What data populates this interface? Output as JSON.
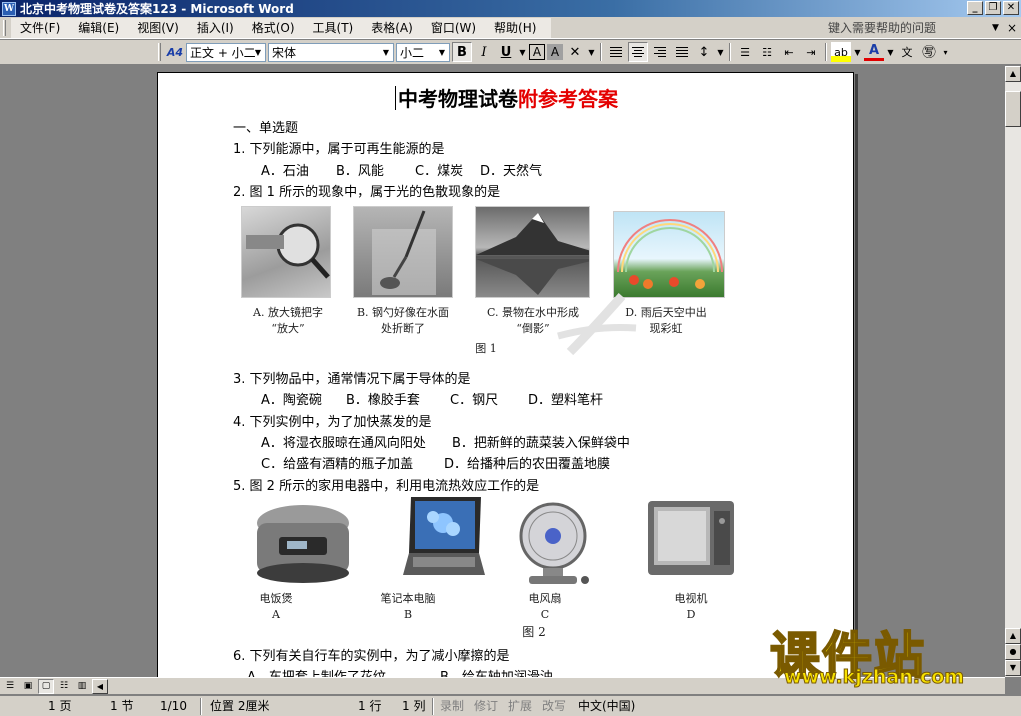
{
  "window": {
    "title": "北京中考物理试卷及答案123 - Microsoft Word",
    "min": "_",
    "restore": "❐",
    "close": "✕"
  },
  "menu": {
    "items": [
      "文件(F)",
      "编辑(E)",
      "视图(V)",
      "插入(I)",
      "格式(O)",
      "工具(T)",
      "表格(A)",
      "窗口(W)",
      "帮助(H)"
    ],
    "help_placeholder": "键入需要帮助的问题",
    "doc_close": "×"
  },
  "toolbar": {
    "style_value": "正文 + 小二",
    "font_value": "宋体",
    "size_value": "小二",
    "bold": "B",
    "italic": "I",
    "underline": "U",
    "char_border": "A",
    "char_shading": "A",
    "font_color": "A",
    "phonetic": "文"
  },
  "document": {
    "title_black": "中考物理试卷",
    "title_red": "附参考答案",
    "section": "一、单选题",
    "q1": "1. 下列能源中，属于可再生能源的是",
    "q1_options": [
      "A．石油",
      "B．风能",
      "C．煤炭",
      "D．天然气"
    ],
    "q2": "2. 图 1 所示的现象中，属于光的色散现象的是",
    "q2_captions": [
      [
        "A.   放大镜把字",
        "“放大”"
      ],
      [
        "B. 钢勺好像在水面",
        "处折断了"
      ],
      [
        "C. 景物在水中形成",
        "“倒影”"
      ],
      [
        "D. 雨后天空中出",
        "现彩虹"
      ]
    ],
    "fig1_label": "图 1",
    "q3": "3. 下列物品中，通常情况下属于导体的是",
    "q3_options": [
      "A．陶瓷碗",
      "B．橡胶手套",
      "C．钢尺",
      "D．塑料笔杆"
    ],
    "q4": "4. 下列实例中，为了加快蒸发的是",
    "q4_options": [
      "A．将湿衣服晾在通风向阳处",
      "B．把新鲜的蔬菜装入保鲜袋中",
      "C．给盛有酒精的瓶子加盖",
      "D．给播种后的农田覆盖地膜"
    ],
    "q5": "5. 图 2 所示的家用电器中，利用电流热效应工作的是",
    "q5_captions": [
      [
        "电饭煲",
        "A"
      ],
      [
        "笔记本电脑",
        "B"
      ],
      [
        "电风扇",
        "C"
      ],
      [
        "电视机",
        "D"
      ]
    ],
    "fig2_label": "图 2",
    "q6": "6. 下列有关自行车的实例中，为了减小摩擦的是",
    "q6_options": [
      "A．车把套上制作了花纹",
      "B．给车轴加润滑油"
    ]
  },
  "status": {
    "page": "1 页",
    "section": "1 节",
    "pages": "1/10",
    "position": "位置 2厘米",
    "line": "1 行",
    "col": "1 列",
    "rec": "录制",
    "trk": "修订",
    "ext": "扩展",
    "ovr": "改写",
    "lang": "中文(中国)"
  },
  "watermark": {
    "brand": "课件站",
    "url": "www.kjzhan.com"
  }
}
